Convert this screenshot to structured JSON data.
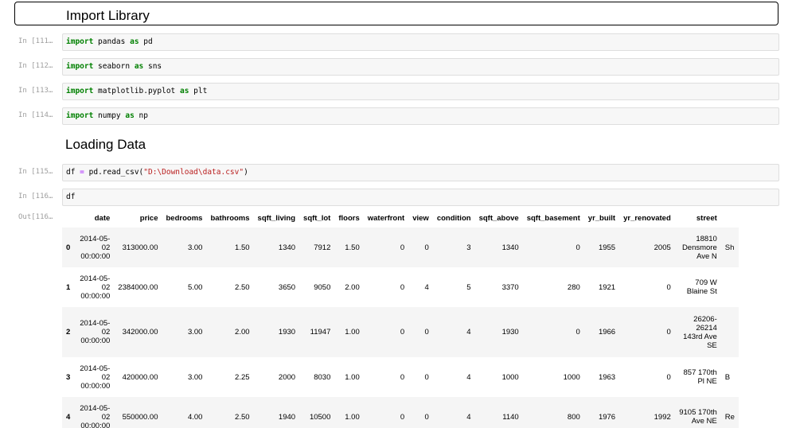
{
  "heading_import": "Import Library",
  "heading_loading": "Loading Data",
  "cells": [
    {
      "prompt": "In [111…",
      "parts": [
        {
          "t": "import",
          "c": "kw"
        },
        {
          "t": " pandas "
        },
        {
          "t": "as",
          "c": "kw"
        },
        {
          "t": " pd"
        }
      ]
    },
    {
      "prompt": "In [112…",
      "parts": [
        {
          "t": "import",
          "c": "kw"
        },
        {
          "t": " seaborn "
        },
        {
          "t": "as",
          "c": "kw"
        },
        {
          "t": " sns"
        }
      ]
    },
    {
      "prompt": "In [113…",
      "parts": [
        {
          "t": "import",
          "c": "kw"
        },
        {
          "t": " matplotlib.pyplot "
        },
        {
          "t": "as",
          "c": "kw"
        },
        {
          "t": " plt"
        }
      ]
    },
    {
      "prompt": "In [114…",
      "parts": [
        {
          "t": "import",
          "c": "kw"
        },
        {
          "t": " numpy "
        },
        {
          "t": "as",
          "c": "kw"
        },
        {
          "t": " np"
        }
      ]
    },
    {
      "prompt": "In [115…",
      "parts": [
        {
          "t": "df "
        },
        {
          "t": "=",
          "c": "op"
        },
        {
          "t": " pd.read_csv("
        },
        {
          "t": "\"D:\\Download\\data.csv\"",
          "c": "str"
        },
        {
          "t": ")"
        }
      ]
    },
    {
      "prompt": "In [116…",
      "parts": [
        {
          "t": "df"
        }
      ]
    }
  ],
  "output_prompt": "Out[116…",
  "table": {
    "columns": [
      "",
      "date",
      "price",
      "bedrooms",
      "bathrooms",
      "sqft_living",
      "sqft_lot",
      "floors",
      "waterfront",
      "view",
      "condition",
      "sqft_above",
      "sqft_basement",
      "yr_built",
      "yr_renovated",
      "street",
      ""
    ],
    "rows": [
      [
        "0",
        "2014-05-02 00:00:00",
        "313000.00",
        "3.00",
        "1.50",
        "1340",
        "7912",
        "1.50",
        "0",
        "0",
        "3",
        "1340",
        "0",
        "1955",
        "2005",
        "18810 Densmore Ave N",
        "Sh"
      ],
      [
        "1",
        "2014-05-02 00:00:00",
        "2384000.00",
        "5.00",
        "2.50",
        "3650",
        "9050",
        "2.00",
        "0",
        "4",
        "5",
        "3370",
        "280",
        "1921",
        "0",
        "709 W Blaine St",
        ""
      ],
      [
        "2",
        "2014-05-02 00:00:00",
        "342000.00",
        "3.00",
        "2.00",
        "1930",
        "11947",
        "1.00",
        "0",
        "0",
        "4",
        "1930",
        "0",
        "1966",
        "0",
        "26206-26214 143rd Ave SE",
        ""
      ],
      [
        "3",
        "2014-05-02 00:00:00",
        "420000.00",
        "3.00",
        "2.25",
        "2000",
        "8030",
        "1.00",
        "0",
        "0",
        "4",
        "1000",
        "1000",
        "1963",
        "0",
        "857 170th Pl NE",
        "B"
      ],
      [
        "4",
        "2014-05-02 00:00:00",
        "550000.00",
        "4.00",
        "2.50",
        "1940",
        "10500",
        "1.00",
        "0",
        "0",
        "4",
        "1140",
        "800",
        "1976",
        "1992",
        "9105 170th Ave NE",
        "Re"
      ]
    ]
  }
}
